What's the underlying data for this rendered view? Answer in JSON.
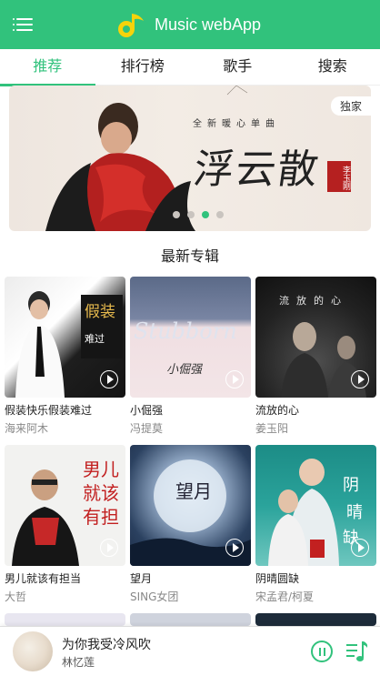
{
  "header": {
    "title": "Music webApp",
    "brand_color": "#31c27c"
  },
  "tabs": [
    {
      "label": "推荐",
      "active": true
    },
    {
      "label": "排行榜",
      "active": false
    },
    {
      "label": "歌手",
      "active": false
    },
    {
      "label": "搜索",
      "active": false
    }
  ],
  "banner": {
    "badge": "独家",
    "subtitle": "全新暖心单曲",
    "title": "浮云散",
    "seal": "李玉刚",
    "slide_count": 4,
    "active_slide": 3
  },
  "section_title": "最新专辑",
  "albums": [
    {
      "name": "假装快乐假装难过",
      "artist": "海来阿木",
      "cover_text": "快乐假装难过"
    },
    {
      "name": "小倔强",
      "artist": "冯提莫",
      "cover_text": "Stubborn"
    },
    {
      "name": "流放的心",
      "artist": "姜玉阳",
      "cover_text": "流放的心"
    },
    {
      "name": "男儿就该有担当",
      "artist": "大哲",
      "cover_text": "男儿就该有担当"
    },
    {
      "name": "望月",
      "artist": "SING女团",
      "cover_text": "望月"
    },
    {
      "name": "阴晴圆缺",
      "artist": "宋孟君/柯夏",
      "cover_text": "阴晴圆缺"
    }
  ],
  "player": {
    "song": "为你我受冷风吹",
    "artist": "林忆莲",
    "state": "playing"
  }
}
